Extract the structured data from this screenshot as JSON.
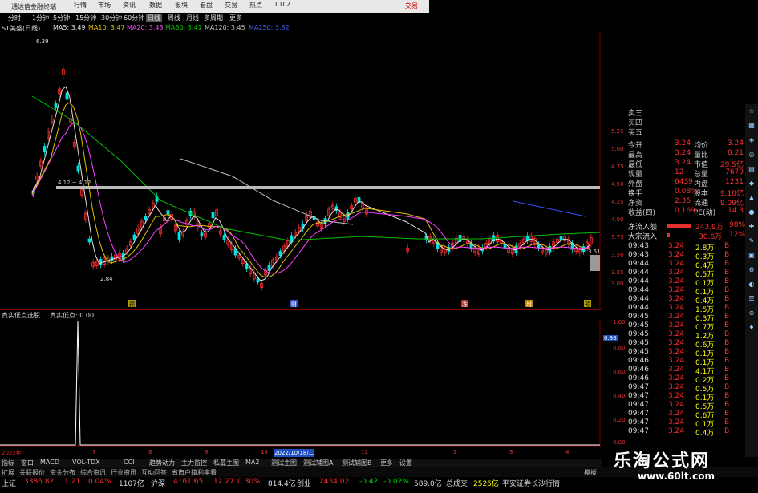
{
  "title_bar": {
    "title": "通达信金融终端",
    "trade_btn": "交易"
  },
  "menu": [
    "行情",
    "市场",
    "资讯",
    "数据",
    "板块",
    "看盘",
    "交易",
    "热点",
    "L1L2"
  ],
  "periods": [
    "分时",
    "1分钟",
    "5分钟",
    "15分钟",
    "30分钟",
    "60分钟",
    "日线",
    "周线",
    "月线",
    "多周期",
    "更多"
  ],
  "active_period": "日线",
  "ma_bar": {
    "stock": "ST美盛(日线)",
    "items": [
      {
        "label": "MA5: 3.49",
        "color": "#e0e0e0"
      },
      {
        "label": "MA10: 3.47",
        "color": "#e0c000"
      },
      {
        "label": "MA20: 3.43",
        "color": "#ff40ff"
      },
      {
        "label": "MA60: 3.41",
        "color": "#00c000"
      },
      {
        "label": "MA120: 3.45",
        "color": "#c0c0c0"
      },
      {
        "label": "MA250: 3.32",
        "color": "#4060ff"
      }
    ]
  },
  "chart": {
    "high_label": "6.39",
    "low_label": "2.84",
    "range_label": "4.12 ~ 4.12",
    "right_label": "3.51",
    "axis_main": [
      "5.25",
      "5.00",
      "4.75",
      "4.50",
      "4.25",
      "4.00",
      "3.75",
      "3.50",
      "3.25",
      "3.00"
    ],
    "markers": [
      "预",
      "财",
      "冻",
      "增",
      "预"
    ],
    "sub_title": "真实低点选股",
    "sub_value_label": "真实低点: 0.00",
    "axis_sub": [
      "1.00",
      "0.86",
      "0.80",
      "0.60",
      "0.40",
      "0.20",
      "0.00"
    ],
    "sub_highlight": "0.86",
    "date_axis": [
      "2022年",
      "7",
      "8",
      "9",
      "10",
      "2022/10/18/二",
      "12",
      "2",
      "3",
      "4"
    ]
  },
  "panel": {
    "bids": [
      "卖三",
      "买四",
      "买五"
    ],
    "stats": [
      [
        "今开",
        "3.24",
        "均价",
        "3.24"
      ],
      [
        "最高",
        "3.24",
        "量比",
        "0.21"
      ],
      [
        "最低",
        "3.24",
        "市值",
        "29.5亿"
      ],
      [
        "现量",
        "12",
        "总量",
        "7670"
      ],
      [
        "外盘",
        "6439",
        "内盘",
        "1231"
      ],
      [
        "换手",
        "0.08%",
        "股本",
        "9.10亿"
      ],
      [
        "净资",
        "2.36",
        "流通",
        "9.09亿"
      ],
      [
        "收益(四)",
        "0.169",
        "PE(动)",
        "14.3"
      ]
    ],
    "flow": [
      [
        "净流入额",
        "243.9万",
        "98%"
      ],
      [
        "大宗流入",
        "30.6万",
        "12%"
      ]
    ],
    "ticks": [
      [
        "09:43",
        "3.24",
        "2.8万",
        "B"
      ],
      [
        "09:43",
        "3.24",
        "0.3万",
        "B"
      ],
      [
        "09:44",
        "3.24",
        "0.4万",
        "B"
      ],
      [
        "09:44",
        "3.24",
        "0.5万",
        "B"
      ],
      [
        "09:44",
        "3.24",
        "0.1万",
        "B"
      ],
      [
        "09:44",
        "3.24",
        "0.1万",
        "B"
      ],
      [
        "09:44",
        "3.24",
        "0.4万",
        "B"
      ],
      [
        "09:44",
        "3.24",
        "1.5万",
        "B"
      ],
      [
        "09:45",
        "3.24",
        "0.3万",
        "B"
      ],
      [
        "09:45",
        "3.24",
        "0.7万",
        "B"
      ],
      [
        "09:45",
        "3.24",
        "1.2万",
        "B"
      ],
      [
        "09:45",
        "3.24",
        "0.6万",
        "B"
      ],
      [
        "09:45",
        "3.24",
        "0.1万",
        "B"
      ],
      [
        "09:46",
        "3.24",
        "0.1万",
        "B"
      ],
      [
        "09:46",
        "3.24",
        "4.1万",
        "B"
      ],
      [
        "09:46",
        "3.24",
        "0.2万",
        "B"
      ],
      [
        "09:47",
        "3.24",
        "0.5万",
        "B"
      ],
      [
        "09:47",
        "3.24",
        "0.1万",
        "B"
      ],
      [
        "09:47",
        "3.24",
        "0.5万",
        "B"
      ],
      [
        "09:47",
        "3.24",
        "0.6万",
        "B"
      ],
      [
        "09:47",
        "3.24",
        "0.1万",
        "B"
      ],
      [
        "09:47",
        "3.24",
        "0.4万",
        "B"
      ]
    ],
    "bottom": [
      "数据",
      "图文F10"
    ]
  },
  "tabs": [
    "指标",
    "窗口",
    "MACD",
    "VOL-TDX",
    "CCI",
    "趋势动力",
    "主力监控",
    "私募主图",
    "MA2",
    "测试主图",
    "测试辅图A",
    "测试辅图B",
    "更多",
    "设置"
  ],
  "tabs2": [
    "扩展",
    "关联报价",
    "资金分布",
    "综合资讯",
    "行业资讯",
    "互动问答",
    "省市户籍利率看",
    "模板"
  ],
  "status": [
    {
      "name": "上证",
      "val": "3386.82",
      "chg": "1.21",
      "pct": "0.04%",
      "amt": "1107亿"
    },
    {
      "name": "沪深",
      "val": "4161.65",
      "chg": "12.27",
      "pct": "0.30%",
      "amt": "814.4亿"
    },
    {
      "name": "创业",
      "val": "2434.02",
      "chg": "-0.42",
      "pct": "-0.02%",
      "amt": "589.0亿"
    }
  ],
  "status_extra": [
    "总成交",
    "2526亿",
    "平安证券长沙行情"
  ],
  "watermark": {
    "title": "乐淘公式网",
    "url": "www.60lt.com"
  },
  "colors": {
    "up": "#ff3030",
    "down": "#00e0e0",
    "bg": "#000000",
    "grid": "#5a0000",
    "yellow": "#ffff00"
  }
}
